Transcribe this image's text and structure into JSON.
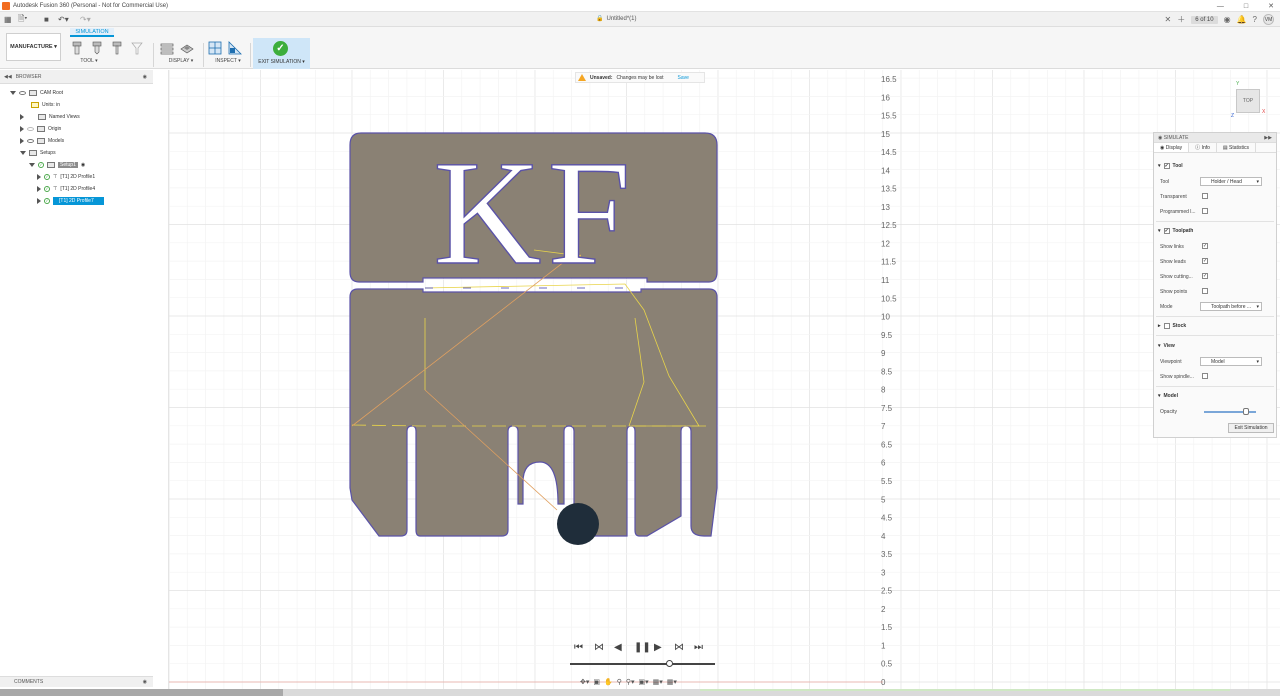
{
  "window": {
    "title": "Autodesk Fusion 360 (Personal - Not for Commercial Use)"
  },
  "tabbar": {
    "doc_title": "Untitled*(1)",
    "jobs": "6 of 10",
    "avatar": "VM"
  },
  "ribbon": {
    "workspace": "MANUFACTURE ▾",
    "active_tab": "SIMULATION",
    "groups": {
      "tool": "TOOL ▾",
      "display": "DISPLAY ▾",
      "inspect": "INSPECT ▾",
      "exit": "EXIT SIMULATION ▾"
    }
  },
  "browser": {
    "title": "BROWSER",
    "nodes": {
      "cam_root": "CAM Root",
      "units": "Units: in",
      "named_views": "Named Views",
      "origin": "Origin",
      "models": "Models",
      "setups": "Setups",
      "setup1": "Setup1",
      "profile1": "[T1] 2D Profile1",
      "profile4": "[T1] 2D Profile4",
      "profile7": "[T1] 2D Profile7"
    },
    "comments": "COMMENTS"
  },
  "notice": {
    "label": "Unsaved:",
    "message": "Changes may be lost",
    "save": "Save"
  },
  "viewcube": {
    "face": "TOP",
    "axis_y": "Y",
    "axis_x": "X",
    "axis_z": "Z"
  },
  "ruler": [
    "16.5",
    "16",
    "15.5",
    "15",
    "14.5",
    "14",
    "13.5",
    "13",
    "12.5",
    "12",
    "11.5",
    "11",
    "10.5",
    "10",
    "9.5",
    "9",
    "8.5",
    "8",
    "7.5",
    "7",
    "6.5",
    "6",
    "5.5",
    "5",
    "4.5",
    "4",
    "3.5",
    "3",
    "2.5",
    "2",
    "1.5",
    "1",
    "0.5",
    "0"
  ],
  "part_text": "KF",
  "simulate": {
    "title": "SIMULATE",
    "tabs": [
      "Display",
      "Info",
      "Statistics"
    ],
    "tool_section": "Tool",
    "tool_label": "Tool",
    "tool_value": "Holder / Head",
    "transparent": "Transparent",
    "programmed": "Programmed l...",
    "toolpath_section": "Toolpath",
    "show_links": "Show links",
    "show_leads": "Show leads",
    "show_cutting": "Show cutting...",
    "show_points": "Show points",
    "mode": "Mode",
    "mode_value": "Toolpath before ...",
    "stock_section": "Stock",
    "view_section": "View",
    "viewpoint": "Viewpoint",
    "viewpoint_value": "Model",
    "show_spindle": "Show spindle...",
    "model_section": "Model",
    "opacity": "Opacity",
    "opacity_level": 0.8,
    "exit_button": "Exit Simulation"
  },
  "playback": {
    "position": 0.68
  },
  "colors": {
    "accent": "#0696d7",
    "stock": "#8a8174",
    "toolpath": "#e8d44a",
    "tool": "#1f2d3a"
  }
}
